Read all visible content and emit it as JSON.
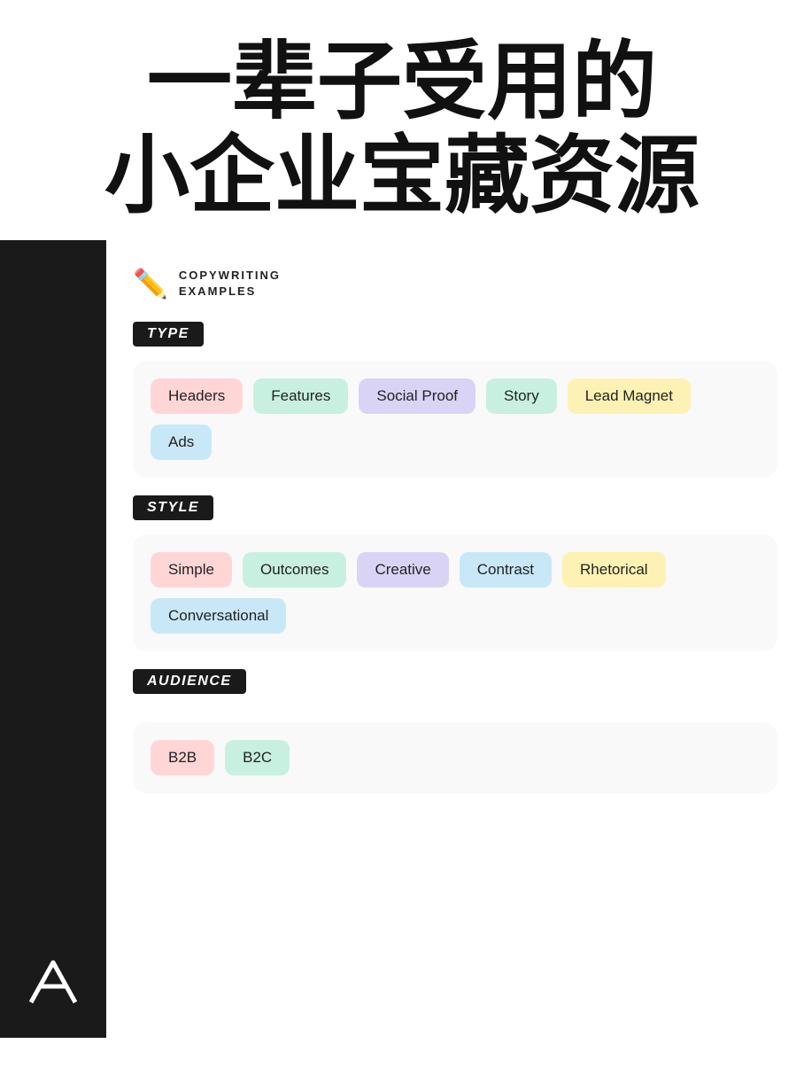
{
  "title": {
    "line1": "一辈子受用的",
    "line2": "小企业宝藏资源"
  },
  "card": {
    "pencil": "✏️",
    "title_line1": "COPYWRITING",
    "title_line2": "EXAMPLES"
  },
  "sections": {
    "type": {
      "label": "TYPE",
      "tags": [
        {
          "text": "Headers",
          "color": "tag-pink"
        },
        {
          "text": "Features",
          "color": "tag-green"
        },
        {
          "text": "Social Proof",
          "color": "tag-purple"
        },
        {
          "text": "Story",
          "color": "tag-green"
        },
        {
          "text": "Lead Magnet",
          "color": "tag-yellow"
        },
        {
          "text": "Ads",
          "color": "tag-blue"
        }
      ]
    },
    "style": {
      "label": "STYLE",
      "tags": [
        {
          "text": "Simple",
          "color": "tag-pink"
        },
        {
          "text": "Outcomes",
          "color": "tag-green"
        },
        {
          "text": "Creative",
          "color": "tag-purple"
        },
        {
          "text": "Contrast",
          "color": "tag-blue"
        },
        {
          "text": "Rhetorical",
          "color": "tag-yellow"
        },
        {
          "text": "Conversational",
          "color": "tag-blue"
        }
      ]
    },
    "audience": {
      "label": "AUDIENCE",
      "tags": [
        {
          "text": "B2B",
          "color": "tag-pink"
        },
        {
          "text": "B2C",
          "color": "tag-green"
        }
      ]
    }
  }
}
